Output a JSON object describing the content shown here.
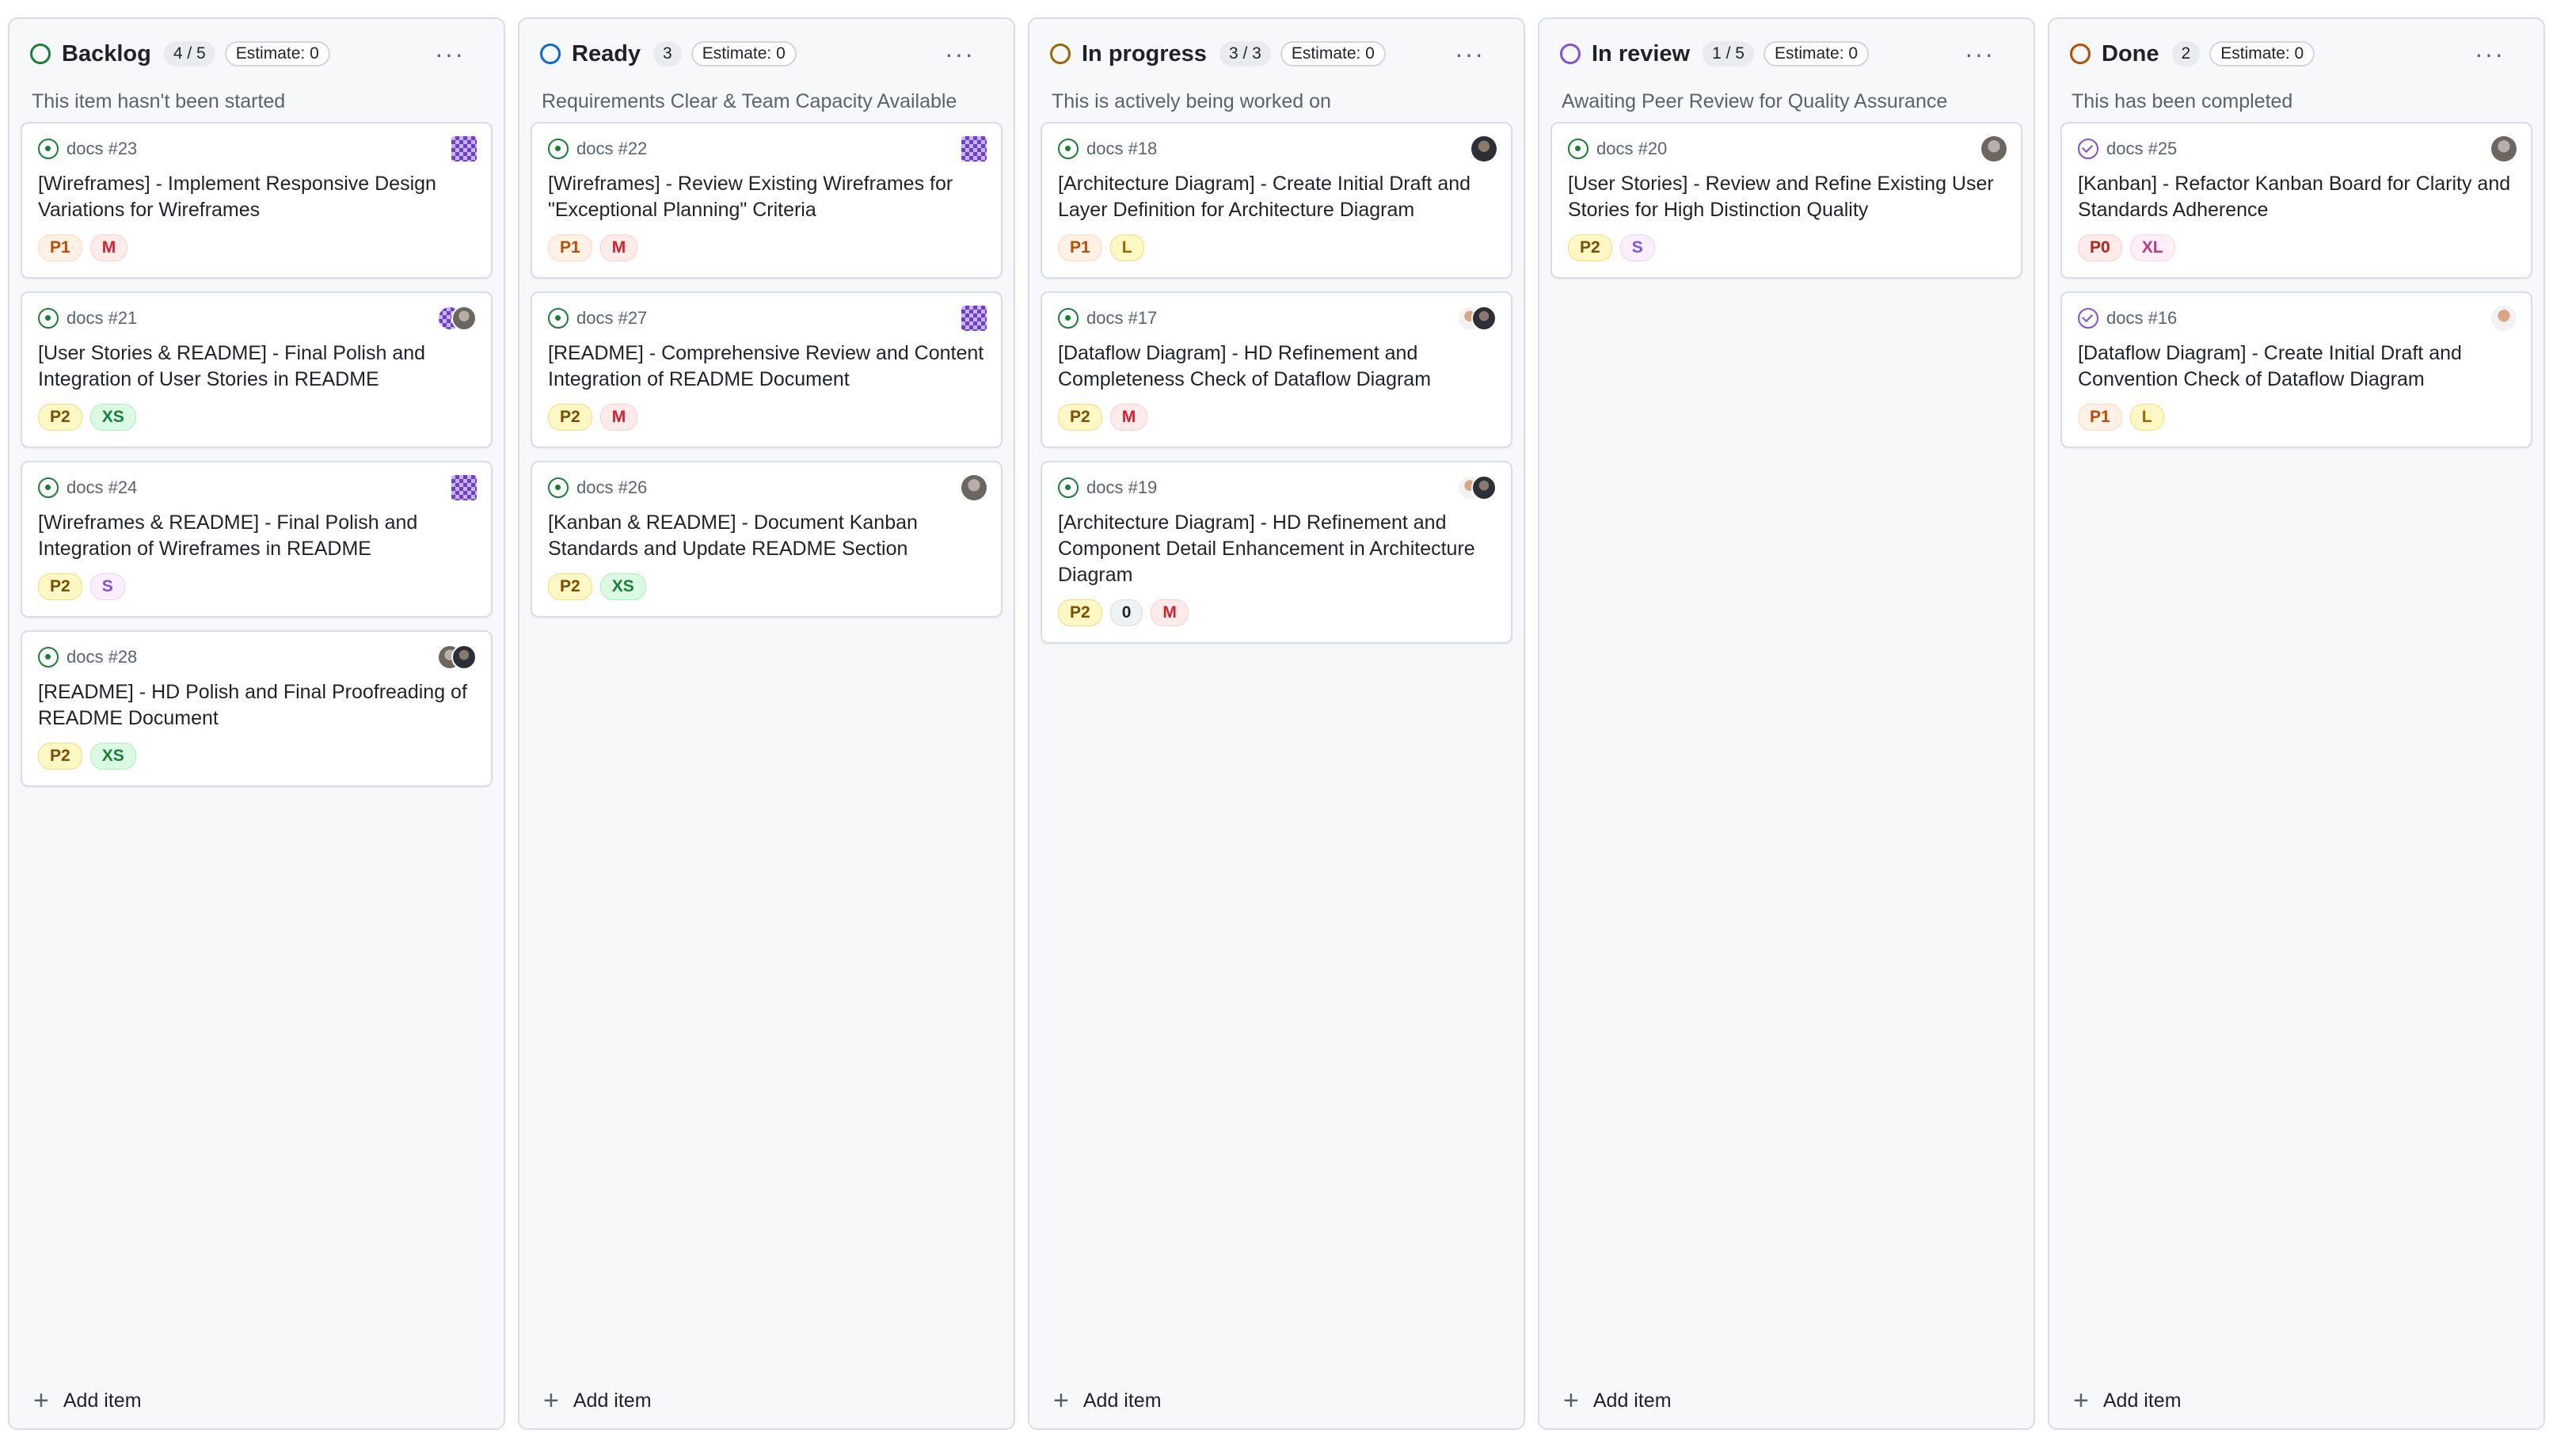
{
  "columns": [
    {
      "title": "Backlog",
      "count": "4 / 5",
      "estimate": "Estimate: 0",
      "description": "This item hasn't been started",
      "status_color": "#1a7f37",
      "add_item": "Add item",
      "cards": [
        {
          "ref": "docs #23",
          "title": "[Wireframes] - Implement Responsive Design Variations for Wireframes",
          "labels": [
            "P1",
            "M"
          ]
        },
        {
          "ref": "docs #21",
          "title": "[User Stories & README] - Final Polish and Integration of User Stories in README",
          "labels": [
            "P2",
            "XS"
          ]
        },
        {
          "ref": "docs #24",
          "title": "[Wireframes & README] - Final Polish and Integration of Wireframes in README",
          "labels": [
            "P2",
            "S"
          ]
        },
        {
          "ref": "docs #28",
          "title": "[README] - HD Polish and Final Proofreading of README Document",
          "labels": [
            "P2",
            "XS"
          ]
        }
      ]
    },
    {
      "title": "Ready",
      "count": "3",
      "estimate": "Estimate: 0",
      "description": "Requirements Clear & Team Capacity Available",
      "status_color": "#0969da",
      "add_item": "Add item",
      "cards": [
        {
          "ref": "docs #22",
          "title": "[Wireframes] - Review Existing Wireframes for \"Exceptional Planning\" Criteria",
          "labels": [
            "P1",
            "M"
          ]
        },
        {
          "ref": "docs #27",
          "title": "[README] - Comprehensive Review and Content Integration of README Document",
          "labels": [
            "P2",
            "M"
          ]
        },
        {
          "ref": "docs #26",
          "title": "[Kanban & README] - Document Kanban Standards and Update README Section",
          "labels": [
            "P2",
            "XS"
          ]
        }
      ]
    },
    {
      "title": "In progress",
      "count": "3 / 3",
      "estimate": "Estimate: 0",
      "description": "This is actively being worked on",
      "status_color": "#9a6700",
      "add_item": "Add item",
      "cards": [
        {
          "ref": "docs #18",
          "title": "[Architecture Diagram] - Create Initial Draft and Layer Definition for Architecture Diagram",
          "labels": [
            "P1",
            "L"
          ]
        },
        {
          "ref": "docs #17",
          "title": "[Dataflow Diagram] - HD Refinement and Completeness Check of Dataflow Diagram",
          "labels": [
            "P2",
            "M"
          ]
        },
        {
          "ref": "docs #19",
          "title": "[Architecture Diagram] - HD Refinement and Component Detail Enhancement in Architecture Diagram",
          "labels": [
            "P2",
            "0",
            "M"
          ]
        }
      ]
    },
    {
      "title": "In review",
      "count": "1 / 5",
      "estimate": "Estimate: 0",
      "description": "Awaiting Peer Review for Quality Assurance",
      "status_color": "#8250df",
      "add_item": "Add item",
      "cards": [
        {
          "ref": "docs #20",
          "title": "[User Stories] - Review and Refine Existing User Stories for High Distinction Quality",
          "labels": [
            "P2",
            "S"
          ]
        }
      ]
    },
    {
      "title": "Done",
      "count": "2",
      "estimate": "Estimate: 0",
      "description": "This has been completed",
      "status_color": "#bc4c00",
      "add_item": "Add item",
      "cards": [
        {
          "ref": "docs #25",
          "title": "[Kanban] - Refactor Kanban Board for Clarity and Standards Adherence",
          "labels": [
            "P0",
            "XL"
          ]
        },
        {
          "ref": "docs #16",
          "title": "[Dataflow Diagram] - Create Initial Draft and Convention Check of Dataflow Diagram",
          "labels": [
            "P1",
            "L"
          ]
        }
      ]
    }
  ],
  "more_icon": "kebab-horizontal-icon",
  "add_icon": "plus-icon"
}
